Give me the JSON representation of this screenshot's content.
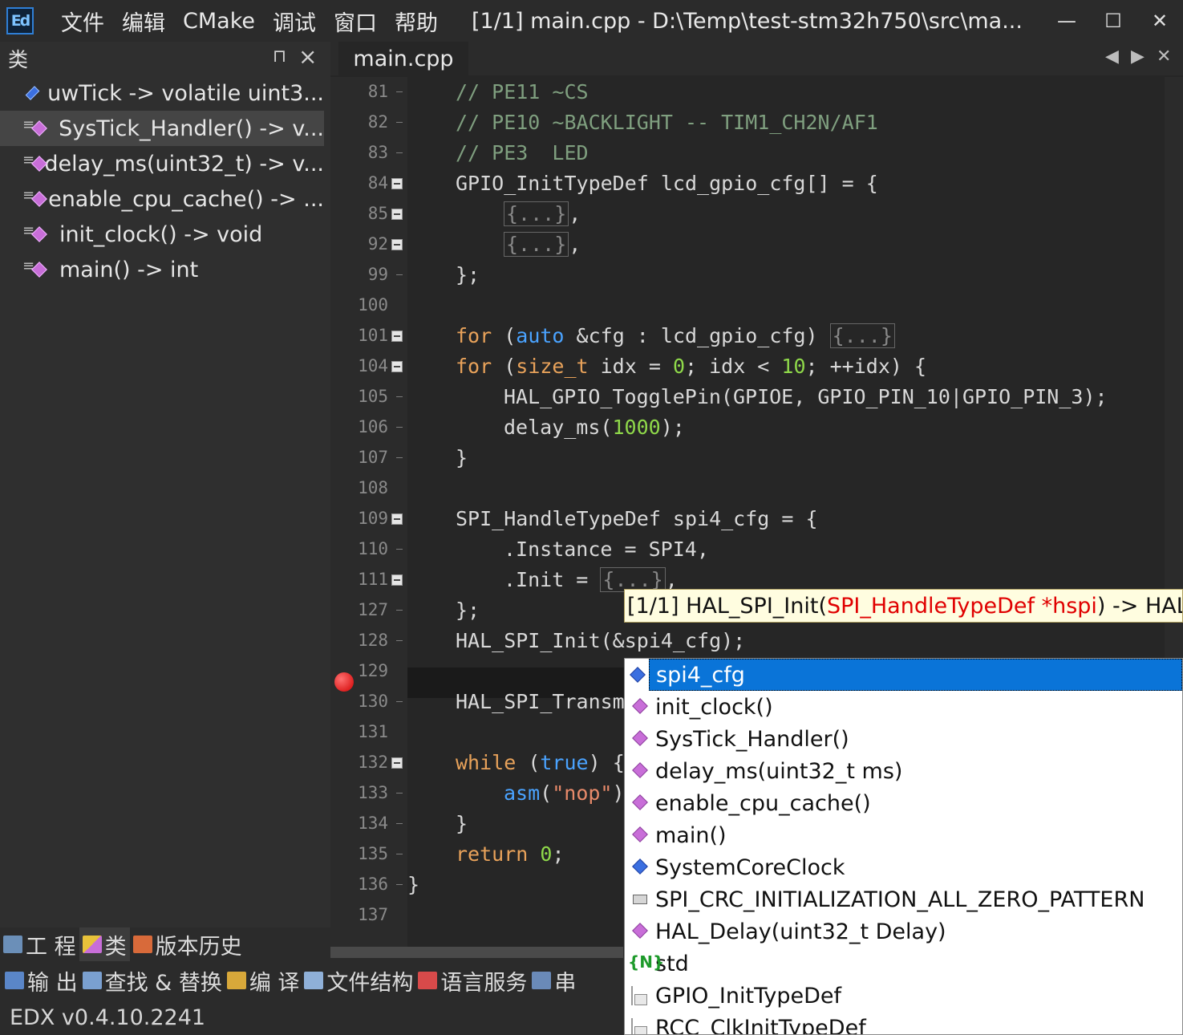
{
  "app": {
    "icon_text": "Ed",
    "menu": [
      "文件",
      "编辑",
      "CMake",
      "调试",
      "窗口",
      "帮助"
    ],
    "window_title": "[1/1] main.cpp - D:\\Temp\\test-stm32h750\\src\\ma...",
    "controls": {
      "minimize": "—",
      "maximize": "☐",
      "close": "✕"
    }
  },
  "class_panel": {
    "title": "类",
    "pin": "⊓",
    "close": "×",
    "items": [
      {
        "label": "uwTick -> volatile uint3...",
        "icon": "variable-icon"
      },
      {
        "label": "SysTick_Handler() -> v...",
        "icon": "function-icon",
        "selected": true
      },
      {
        "label": "delay_ms(uint32_t) -> v...",
        "icon": "function-icon"
      },
      {
        "label": "enable_cpu_cache() -> ...",
        "icon": "function-icon"
      },
      {
        "label": "init_clock() -> void",
        "icon": "function-icon"
      },
      {
        "label": "main() -> int",
        "icon": "function-icon"
      }
    ],
    "tabs": [
      "工 程",
      "类",
      "版本历史"
    ]
  },
  "bottom_tabs": [
    "输 出",
    "查找 & 替换",
    "编 译",
    "文件结构",
    "语言服务",
    "串"
  ],
  "status": {
    "version": "EDX v0.4.10.2241"
  },
  "editor": {
    "tab": "main.cpp",
    "nav": {
      "prev": "◀",
      "next": "▶",
      "close": "✕"
    },
    "collapsed": "{...}",
    "lines": [
      {
        "n": "81",
        "code": "// PE11 ~CS"
      },
      {
        "n": "82",
        "code": "// PE10 ~BACKLIGHT -- TIM1_CH2N/AF1"
      },
      {
        "n": "83",
        "code": "// PE3  LED"
      },
      {
        "n": "84",
        "code": "GPIO_InitTypeDef lcd_gpio_cfg[] = {"
      },
      {
        "n": "85",
        "code": ","
      },
      {
        "n": "92",
        "code": ","
      },
      {
        "n": "99",
        "code": "};"
      },
      {
        "n": "100",
        "code": ""
      },
      {
        "n": "101",
        "kw": "for",
        "code_a": " (",
        "type": "auto",
        "code_b": " &cfg : lcd_gpio_cfg) "
      },
      {
        "n": "104",
        "kw": "for",
        "code_a": " (",
        "type": "size_t",
        "code_b": " idx = ",
        "num1": "0",
        "code_c": "; idx < ",
        "num2": "10",
        "code_d": "; ++idx) {"
      },
      {
        "n": "105",
        "code": "HAL_GPIO_TogglePin(GPIOE, GPIO_PIN_10|GPIO_PIN_3);"
      },
      {
        "n": "106",
        "code_a": "delay_ms(",
        "num": "1000",
        "code_b": ");"
      },
      {
        "n": "107",
        "code": "}"
      },
      {
        "n": "108",
        "code": ""
      },
      {
        "n": "109",
        "code": "SPI_HandleTypeDef spi4_cfg = {"
      },
      {
        "n": "110",
        "code": ".Instance = SPI4,"
      },
      {
        "n": "111",
        "code": ".Init = "
      },
      {
        "n": "127",
        "code": "};"
      },
      {
        "n": "128",
        "code": "HAL_SPI_Init(&spi4_cfg);"
      },
      {
        "n": "129",
        "code": ""
      },
      {
        "n": "130",
        "code": "HAL_SPI_Transm"
      },
      {
        "n": "131",
        "code": ""
      },
      {
        "n": "132",
        "kw": "while",
        "code_a": " (",
        "type": "true",
        "code_b": ") {"
      },
      {
        "n": "133",
        "type": "asm",
        "code_a": "(",
        "str": "\"nop\"",
        "code_b": ")"
      },
      {
        "n": "134",
        "code": "}"
      },
      {
        "n": "135",
        "kw": "return",
        "code_a": " ",
        "num": "0",
        "code_b": ";"
      },
      {
        "n": "136",
        "code": "}"
      },
      {
        "n": "137",
        "code": ""
      }
    ]
  },
  "signature": {
    "prefix": "[1/1] HAL_SPI_Init(",
    "param": "SPI_HandleTypeDef *hspi",
    "suffix": ") -> HAL"
  },
  "completion": [
    {
      "label": "spi4_cfg",
      "icon": "variable-icon",
      "selected": true
    },
    {
      "label": "init_clock()",
      "icon": "function-icon"
    },
    {
      "label": "SysTick_Handler()",
      "icon": "function-icon"
    },
    {
      "label": "delay_ms(uint32_t ms)",
      "icon": "function-icon"
    },
    {
      "label": "enable_cpu_cache()",
      "icon": "function-icon"
    },
    {
      "label": "main()",
      "icon": "function-icon"
    },
    {
      "label": "SystemCoreClock",
      "icon": "variable-icon"
    },
    {
      "label": "SPI_CRC_INITIALIZATION_ALL_ZERO_PATTERN",
      "icon": "macro-icon"
    },
    {
      "label": "HAL_Delay(uint32_t Delay)",
      "icon": "function-icon"
    },
    {
      "label": "std",
      "icon": "namespace-icon",
      "glyph": "{N}"
    },
    {
      "label": "GPIO_InitTypeDef",
      "icon": "struct-icon"
    },
    {
      "label": "RCC_ClkInitTypeDef",
      "icon": "struct-icon"
    }
  ],
  "colors": {
    "comment": "#7f9f7f",
    "keyword": "#e8a25a",
    "type": "#4aa3ff",
    "number": "#8fd94a",
    "selection": "#0a74d8",
    "breakpoint": "#d10000"
  }
}
